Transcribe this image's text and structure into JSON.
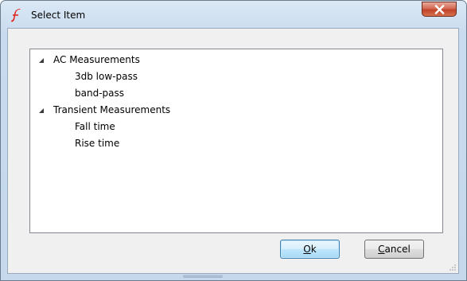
{
  "window": {
    "title": "Select Item",
    "app_icon": "simetrix-logo-icon",
    "close_icon": "close-icon"
  },
  "tree": {
    "groups": [
      {
        "label": "AC Measurements",
        "expanded": true,
        "children": [
          "3db low-pass",
          "band-pass"
        ]
      },
      {
        "label": "Transient Measurements",
        "expanded": true,
        "children": [
          "Fall time",
          "Rise time"
        ]
      }
    ]
  },
  "buttons": {
    "ok_mnemonic": "O",
    "ok_rest": "k",
    "cancel_mnemonic": "C",
    "cancel_rest": "ancel"
  },
  "colors": {
    "title_bar": "#c9dcef",
    "client_bg": "#f0f0f0",
    "close_button": "#c2442a",
    "default_button_border": "#3c7fb1"
  }
}
